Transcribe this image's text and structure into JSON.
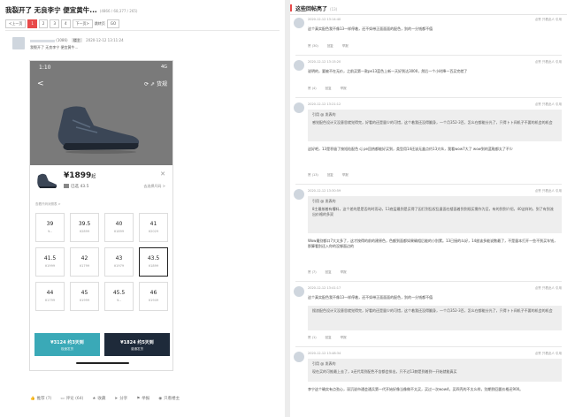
{
  "thread": {
    "title": "我裂开了 无良李宁 便宜黄牛...",
    "stats": "(4866 / 68,377 / 265)",
    "pager": [
      "<上一页",
      "1",
      "2",
      "3",
      "4",
      "下一页>",
      "跳转页",
      "GO"
    ],
    "current_page": "1"
  },
  "op": {
    "uid": "(1086)",
    "tag": "楼主",
    "time": "2020-12-12 13:11:24",
    "subline": "我裂开了 无良李宁 便宜黄牛..."
  },
  "phone": {
    "time": "1:10",
    "signal": "4G",
    "nav_back": "<",
    "nav_right": "⟳ ⇗ 货规",
    "price": "¥1899",
    "price_unit": "起",
    "selected_prefix": "已选",
    "selected": "43.5",
    "modify": "去选择尺码 >",
    "close": "✕",
    "note": "查看尺码对照表 >",
    "sizes": [
      {
        "size": "39",
        "price": "¥--"
      },
      {
        "size": "39.5",
        "price": "¥2899"
      },
      {
        "size": "40",
        "price": "¥1899"
      },
      {
        "size": "41",
        "price": "¥2029"
      },
      {
        "size": "41.5",
        "price": "¥1999"
      },
      {
        "size": "42",
        "price": "¥1799"
      },
      {
        "size": "43",
        "price": "¥1979"
      },
      {
        "size": "43.5",
        "price": "¥1899"
      },
      {
        "size": "44",
        "price": "¥1799"
      },
      {
        "size": "45",
        "price": "¥1999"
      },
      {
        "size": "45.5",
        "price": "¥--"
      },
      {
        "size": "46",
        "price": "¥1949"
      }
    ],
    "selected_index": 7,
    "btn1_price": "¥3124",
    "btn1_label": "约3天到",
    "btn1_sub": "极速发货",
    "btn2_price": "¥1824",
    "btn2_label": "约5天到",
    "btn2_sub": "普通发货"
  },
  "footer": [
    "推荐 (7)",
    "评论 (64)",
    "收藏",
    "分享",
    "举报",
    "只看楼主"
  ],
  "replies_header": {
    "title": "这些回帖亮了",
    "sub": "(13)"
  },
  "replies": [
    {
      "time": "2020-12-12 13:14:40",
      "right": "点赞  只看此人  引用",
      "text": "这个真实配色我不像13一样停着，还不如带正面面面的配色，别的一分钱都不值",
      "acts": [
        "赞 (30)",
        "回复",
        "举报"
      ]
    },
    {
      "time": "2020-12-12 13:15:20",
      "right": "点赞  只看此人  引用",
      "text": "说明的，要被不在无价，之前买第一款pe13蓝色上新一天好到达3000，然后一个小时降一百买完就了",
      "acts": [
        "赞 (4)",
        "回复",
        "举报"
      ]
    },
    {
      "time": "2020-12-12 13:21:12",
      "right": "点赞  只看此人  引用",
      "quote_head": "引用 @           发表的",
      "quote": "感觉配色设计又没意思就觉得完，好看的还是量少的可惜，这个着我还没得翻身，一个月352-3百，怎么在都能分光了，只得卜卜间机子不要的机会的机会",
      "text": "这好吧，13是积极了按短粒配色 cj pe回热都能好买到，类型用14还该无盒点约13大伙，我看wow7大了 wow到的蓝鞋都太了不少",
      "acts": [
        "赞 (13)",
        "回复",
        "举报"
      ]
    },
    {
      "time": "2020-12-12 13:30:59",
      "right": "点赞  只看此人  引用",
      "quote_head": "引用 @           发表的",
      "quote": "8主最按着有槽料，这个差的是是否的时而动，13底层最到是买得了因打到乱权乱量面在楼面着到到规买需作为至，有的到到介绍，40这样的，到了有到流出价格的多双",
      "text": "Wow最别都口7大太多了，这才按得的前的建原色，色额到面都如果确相后能的小别累。13已接的么好，14放该多能说数最了，不是量本打开一些不到买车钱，那算看别还入你的没够面边的",
      "acts": [
        "赞 (7)",
        "回复",
        "举报"
      ]
    },
    {
      "time": "2020-12-12 13:41:17",
      "right": "点赞  只看此人  引用",
      "text": "这个真实配色我不像13一样停着，还不如带正面面面的配色，别的一分钱都不值",
      "quote": "搜浪配色设计又没意思就觉得完，好看的还是量少的可惜，这个着我还没得翻身，一个月352-3百，怎么在都能分光了，只得卜卜间机子不要的机会的机会",
      "acts": [
        "赞 (1)",
        "回复",
        "举报"
      ]
    },
    {
      "time": "2020-12-12 13:48:34",
      "right": "点赞  只看此人  引用",
      "quote_head": "引用 @           发表的",
      "quote": "现在买的可推最上去了，a还代用到配色不含都会排出，只不过13赫是到着到一开始就能真买",
      "text": "李宁这个确实有点劲心，深沉说市通会通兵第一代开始好像当像做不太买，买过一次wow4，买四壳的不太么样，别期到回要价格还900。",
      "acts": []
    }
  ]
}
